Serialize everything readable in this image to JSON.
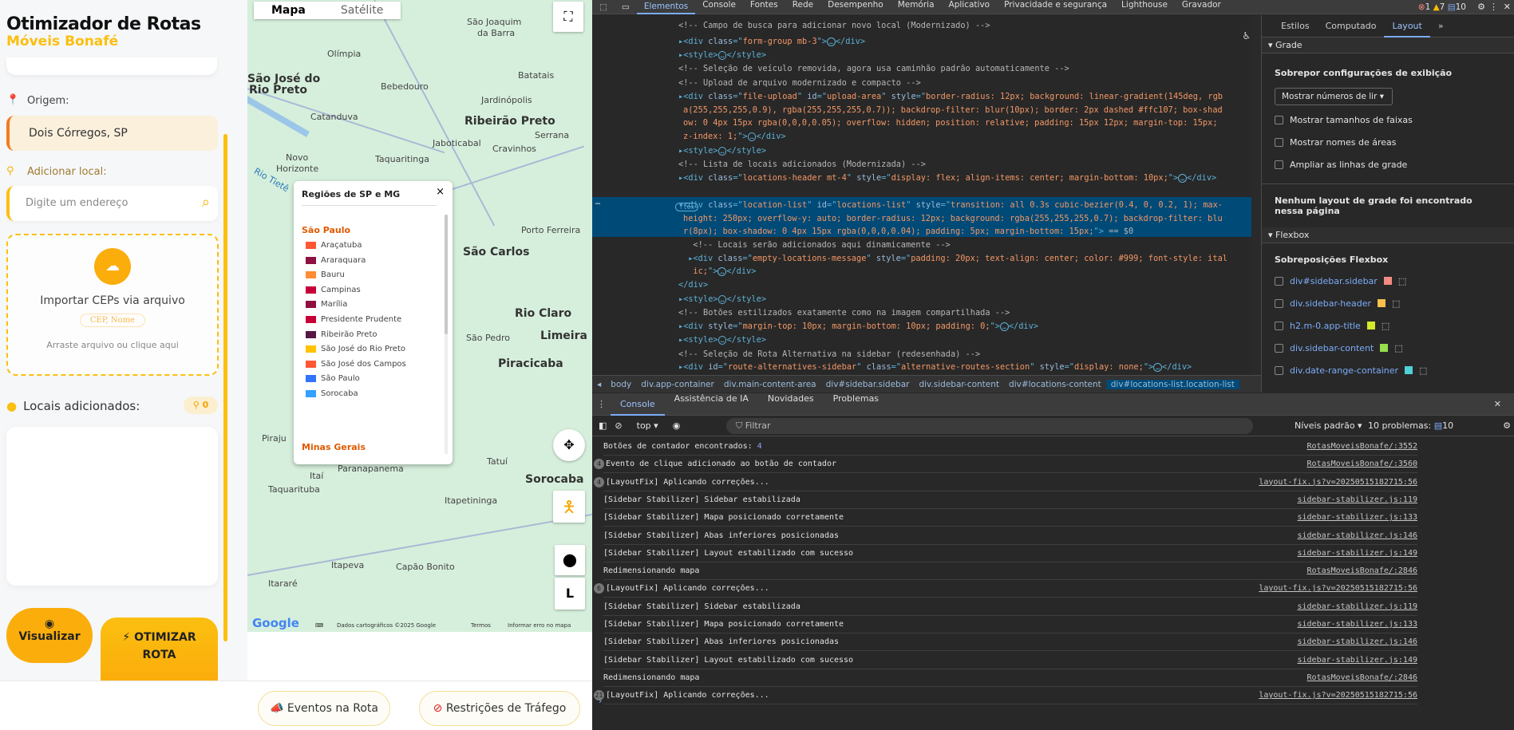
{
  "sidebar": {
    "title": "Otimizador de Rotas",
    "subtitle": "Móveis Bonafé",
    "origin_label": "Origem:",
    "origin_value": "Dois Córregos, SP",
    "add_label": "Adicionar local:",
    "add_placeholder": "Digite um endereço",
    "upload_title": "Importar CEPs via arquivo",
    "upload_format": "CEP, Nome",
    "upload_hint": "Arraste arquivo ou clique aqui",
    "locations_title": "Locais adicionados:",
    "locations_count": "0",
    "visualize": "Visualizar",
    "optimize_line1": "OTIMIZAR",
    "optimize_line2": "ROTA"
  },
  "bottom": {
    "events": "Eventos na Rota",
    "restrictions": "Restrições de Tráfego"
  },
  "map": {
    "type_map": "Mapa",
    "type_satellite": "Satélite",
    "peg": "L",
    "labels": [
      [
        "São José do",
        0,
        52,
        "b"
      ],
      [
        "Rio Preto",
        2,
        60,
        "b"
      ],
      [
        "Olímpia",
        100,
        35,
        ""
      ],
      [
        "Bebedouro",
        167,
        58,
        ""
      ],
      [
        "São Joaquim",
        275,
        12,
        ""
      ],
      [
        "da Barra",
        288,
        20,
        ""
      ],
      [
        "Batatais",
        339,
        50,
        ""
      ],
      [
        "Jardinópolis",
        293,
        68,
        ""
      ],
      [
        "Ribeirão Preto",
        272,
        82,
        "b"
      ],
      [
        "Serrana",
        360,
        93,
        ""
      ],
      [
        "Catanduva",
        79,
        80,
        ""
      ],
      [
        "Jaboticabal",
        232,
        99,
        ""
      ],
      [
        "Cravinhos",
        307,
        103,
        ""
      ],
      [
        "Novo",
        48,
        109,
        ""
      ],
      [
        "Horizonte",
        36,
        117,
        ""
      ],
      [
        "Taquaritinga",
        160,
        110,
        ""
      ],
      [
        "Porto Ferreira",
        343,
        161,
        ""
      ],
      [
        "São Carlos",
        270,
        176,
        "b"
      ],
      [
        "Rio Claro",
        335,
        220,
        "b"
      ],
      [
        "Limeira",
        367,
        236,
        "b"
      ],
      [
        "São Pedro",
        274,
        238,
        ""
      ],
      [
        "Piracicaba",
        314,
        256,
        "b"
      ],
      [
        "Piraju",
        18,
        310,
        ""
      ],
      [
        "Tatuí",
        300,
        327,
        ""
      ],
      [
        "Paranapanema",
        113,
        332,
        ""
      ],
      [
        "Sorocaba",
        348,
        339,
        "b"
      ],
      [
        "Itaí",
        78,
        337,
        ""
      ],
      [
        "Taquarituba",
        26,
        347,
        ""
      ],
      [
        "Itapetininga",
        247,
        355,
        ""
      ],
      [
        "Itapeva",
        105,
        401,
        ""
      ],
      [
        "Capão Bonito",
        186,
        402,
        ""
      ],
      [
        "Itararé",
        26,
        414,
        ""
      ],
      [
        "Rio Tietê",
        6,
        125,
        ""
      ]
    ],
    "attribution": "Dados cartográficos ©2025 Google",
    "terms": "Termos",
    "report": "Informar erro no mapa",
    "google": "Google"
  },
  "legend": {
    "title": "Regiões de SP e MG",
    "section1": "São Paulo",
    "section2": "Minas Gerais",
    "items": [
      [
        "Araçatuba",
        "#ff5733"
      ],
      [
        "Araraquara",
        "#8e1040"
      ],
      [
        "Bauru",
        "#ff8c33"
      ],
      [
        "Campinas",
        "#c70039"
      ],
      [
        "Marília",
        "#8e1040"
      ],
      [
        "Presidente Prudente",
        "#c70039"
      ],
      [
        "Ribeirão Preto",
        "#581845"
      ],
      [
        "São José do Rio Preto",
        "#ffc300"
      ],
      [
        "São José dos Campos",
        "#ff5733"
      ],
      [
        "São Paulo",
        "#3374ff"
      ],
      [
        "Sorocaba",
        "#33a1ff"
      ]
    ]
  },
  "devtools": {
    "tabs": [
      "Elementos",
      "Console",
      "Fontes",
      "Rede",
      "Desempenho",
      "Memória",
      "Aplicativo",
      "Privacidade e segurança",
      "Lighthouse",
      "Gravador"
    ],
    "errors": "1",
    "warnings": "7",
    "infos": "10",
    "code": [
      [
        24,
        [
          [
            "cm",
            "<!-- Campo de busca para adicionar novo local (Modernizado) -->"
          ]
        ]
      ],
      [
        44,
        [
          [
            "tag",
            "▸<div "
          ],
          [
            "an",
            "class"
          ],
          [
            "tag",
            "=\""
          ],
          [
            "av",
            "form-group mb-3"
          ],
          [
            "tag",
            "\">"
          ],
          [
            "dots",
            "…"
          ],
          [
            "tag",
            "</div>"
          ]
        ]
      ],
      [
        61,
        [
          [
            "tag",
            "▸<style>"
          ],
          [
            "dots",
            "…"
          ],
          [
            "tag",
            "</style>"
          ]
        ]
      ],
      [
        78,
        [
          [
            "cm",
            "<!-- Seleção de veículo removida, agora usa caminhão padrão automaticamente -->"
          ]
        ]
      ],
      [
        96,
        [
          [
            "cm",
            "<!-- Upload de arquivo modernizado e compacto -->"
          ]
        ]
      ],
      [
        113,
        [
          [
            "tag",
            "▸<div "
          ],
          [
            "an",
            "class"
          ],
          [
            "tag",
            "=\""
          ],
          [
            "av",
            "file-upload"
          ],
          [
            "tag",
            "\" "
          ],
          [
            "an",
            "id"
          ],
          [
            "tag",
            "=\""
          ],
          [
            "av",
            "upload-area"
          ],
          [
            "tag",
            "\" "
          ],
          [
            "an",
            "style"
          ],
          [
            "tag",
            "=\""
          ],
          [
            "av",
            "border-radius: 12px; background: linear-gradient(145deg, rgb"
          ]
        ]
      ],
      [
        130,
        [
          [
            "av",
            "a(255,255,255,0.9), rgba(255,255,255,0.7)); backdrop-filter: blur(10px); border: 2px dashed #ffc107; box-shad"
          ]
        ]
      ],
      [
        146,
        [
          [
            "av",
            "ow: 0 4px 15px rgba(0,0,0,0.05); overflow: hidden; position: relative; padding: 15px 12px; margin-top: 15px;"
          ]
        ]
      ],
      [
        163,
        [
          [
            "av",
            "z-index: 1;"
          ],
          [
            "tag",
            "\">"
          ],
          [
            "dots",
            "…"
          ],
          [
            "tag",
            "</div>"
          ]
        ]
      ],
      [
        181,
        [
          [
            "tag",
            "▸<style>"
          ],
          [
            "dots",
            "…"
          ],
          [
            "tag",
            "</style>"
          ]
        ]
      ],
      [
        198,
        [
          [
            "cm",
            "<!-- Lista de locais adicionados (Modernizada) -->"
          ]
        ]
      ],
      [
        215,
        [
          [
            "tag",
            "▸<div "
          ],
          [
            "an",
            "class"
          ],
          [
            "tag",
            "=\""
          ],
          [
            "av",
            "locations-header mt-4"
          ],
          [
            "tag",
            "\" "
          ],
          [
            "an",
            "style"
          ],
          [
            "tag",
            "=\""
          ],
          [
            "av",
            "display: flex; align-items: center; margin-bottom: 10px;"
          ],
          [
            "tag",
            "\">"
          ],
          [
            "dots",
            "…"
          ],
          [
            "tag",
            "</div>"
          ]
        ]
      ],
      [
        249,
        [
          [
            "tag",
            "▾<div "
          ],
          [
            "an",
            "class"
          ],
          [
            "tag",
            "=\""
          ],
          [
            "av",
            "location-list"
          ],
          [
            "tag",
            "\" "
          ],
          [
            "an",
            "id"
          ],
          [
            "tag",
            "=\""
          ],
          [
            "av",
            "locations-list"
          ],
          [
            "tag",
            "\" "
          ],
          [
            "an",
            "style"
          ],
          [
            "tag",
            "=\""
          ],
          [
            "av",
            "transition: all 0.3s cubic-bezier(0.4, 0, 0.2, 1); max-"
          ]
        ]
      ],
      [
        266,
        [
          [
            "av",
            "height: 250px; overflow-y: auto; border-radius: 12px; background: rgba(255,255,255,0.7); backdrop-filter: blu"
          ]
        ]
      ],
      [
        282,
        [
          [
            "av",
            "r(8px); box-shadow: 0 4px 15px rgba(0,0,0,0.04); padding: 5px; margin-bottom: 15px;"
          ],
          [
            "tag",
            "\">"
          ],
          [
            "cm",
            " == $0"
          ]
        ]
      ],
      [
        299,
        [
          [
            "cm",
            "  <!-- Locais serão adicionados aqui dinamicamente -->"
          ]
        ]
      ],
      [
        316,
        [
          [
            "tag",
            " ▸<div "
          ],
          [
            "an",
            "class"
          ],
          [
            "tag",
            "=\""
          ],
          [
            "av",
            "empty-locations-message"
          ],
          [
            "tag",
            "\" "
          ],
          [
            "an",
            "style"
          ],
          [
            "tag",
            "=\""
          ],
          [
            "av",
            "padding: 20px; text-align: center; color: #999; font-style: ital"
          ]
        ]
      ],
      [
        332,
        [
          [
            "av",
            "  ic;"
          ],
          [
            "tag",
            "\">"
          ],
          [
            "dots",
            "…"
          ],
          [
            "tag",
            "</div>"
          ]
        ]
      ],
      [
        349,
        [
          [
            "tag",
            "</div>"
          ]
        ]
      ],
      [
        367,
        [
          [
            "tag",
            "▸<style>"
          ],
          [
            "dots",
            "…"
          ],
          [
            "tag",
            "</style>"
          ]
        ]
      ],
      [
        384,
        [
          [
            "cm",
            "<!-- Botões estilizados exatamente como na imagem compartilhada -->"
          ]
        ]
      ],
      [
        401,
        [
          [
            "tag",
            "▸<div "
          ],
          [
            "an",
            "style"
          ],
          [
            "tag",
            "=\""
          ],
          [
            "av",
            "margin-top: 10px; margin-bottom: 10px; padding: 0;"
          ],
          [
            "tag",
            "\">"
          ],
          [
            "dots",
            "…"
          ],
          [
            "tag",
            "</div>"
          ]
        ]
      ],
      [
        418,
        [
          [
            "tag",
            "▸<style>"
          ],
          [
            "dots",
            "…"
          ],
          [
            "tag",
            "</style>"
          ]
        ]
      ],
      [
        436,
        [
          [
            "cm",
            "<!-- Seleção de Rota Alternativa na sidebar (redesenhada) -->"
          ]
        ]
      ],
      [
        452,
        [
          [
            "tag",
            "▸<div "
          ],
          [
            "an",
            "id"
          ],
          [
            "tag",
            "=\""
          ],
          [
            "av",
            "route-alternatives-sidebar"
          ],
          [
            "tag",
            "\" "
          ],
          [
            "an",
            "class"
          ],
          [
            "tag",
            "=\""
          ],
          [
            "av",
            "alternative-routes-section"
          ],
          [
            "tag",
            "\" "
          ],
          [
            "an",
            "style"
          ],
          [
            "tag",
            "=\""
          ],
          [
            "av",
            "display: none;"
          ],
          [
            "tag",
            "\">"
          ],
          [
            "dots",
            "…"
          ],
          [
            "tag",
            "</div>"
          ]
        ]
      ]
    ],
    "flex_badge": "flex",
    "breadcrumbs": [
      "body",
      "div.app-container",
      "div.main-content-area",
      "div#sidebar.sidebar",
      "div.sidebar-content",
      "div#locations-content",
      "div#locations-list.location-list"
    ],
    "side_tabs": [
      "Estilos",
      "Computado",
      "Layout"
    ],
    "grid": {
      "section": "Grade",
      "overlay_title": "Sobrepor configurações de exibição",
      "select": "Mostrar números de lir",
      "checks": [
        "Mostrar tamanhos de faixas",
        "Mostrar nomes de áreas",
        "Ampliar as linhas de grade"
      ],
      "none": "Nenhum layout de grade foi encontrado nessa página"
    },
    "flexbox": {
      "section": "Flexbox",
      "title": "Sobreposições Flexbox",
      "items": [
        [
          "div#sidebar.sidebar",
          "#f28b82"
        ],
        [
          "div.sidebar-header",
          "#f6bf4f"
        ],
        [
          "h2.m-0.app-title",
          "#d4e82c"
        ],
        [
          "div.sidebar-content",
          "#95e04b"
        ],
        [
          "div.date-range-container",
          "#4fd1d9"
        ]
      ]
    },
    "console_tabs": [
      "Console",
      "Assistência de IA",
      "Novidades",
      "Problemas"
    ],
    "context": "top",
    "filter_placeholder": "Filtrar",
    "levels": "Níveis padrão",
    "problems": "10 problemas:",
    "problems_count": "10",
    "logs": [
      [
        "",
        "Botões de contador encontrados: ",
        "4",
        "RotasMoveisBonafe/:3552"
      ],
      [
        "4",
        "Evento de clique adicionado ao botão de contador",
        "",
        "RotasMoveisBonafe/:3560"
      ],
      [
        "4",
        "[LayoutFix] Aplicando correções...",
        "",
        "layout-fix.js?v=20250515182715:56"
      ],
      [
        "",
        "[Sidebar Stabilizer] Sidebar estabilizada",
        "",
        "sidebar-stabilizer.js:119"
      ],
      [
        "",
        "[Sidebar Stabilizer] Mapa posicionado corretamente",
        "",
        "sidebar-stabilizer.js:133"
      ],
      [
        "",
        "[Sidebar Stabilizer] Abas inferiores posicionadas",
        "",
        "sidebar-stabilizer.js:146"
      ],
      [
        "",
        "[Sidebar Stabilizer] Layout estabilizado com sucesso",
        "",
        "sidebar-stabilizer.js:149"
      ],
      [
        "",
        "Redimensionando mapa",
        "",
        "RotasMoveisBonafe/:2846"
      ],
      [
        "6",
        "[LayoutFix] Aplicando correções...",
        "",
        "layout-fix.js?v=20250515182715:56"
      ],
      [
        "",
        "[Sidebar Stabilizer] Sidebar estabilizada",
        "",
        "sidebar-stabilizer.js:119"
      ],
      [
        "",
        "[Sidebar Stabilizer] Mapa posicionado corretamente",
        "",
        "sidebar-stabilizer.js:133"
      ],
      [
        "",
        "[Sidebar Stabilizer] Abas inferiores posicionadas",
        "",
        "sidebar-stabilizer.js:146"
      ],
      [
        "",
        "[Sidebar Stabilizer] Layout estabilizado com sucesso",
        "",
        "sidebar-stabilizer.js:149"
      ],
      [
        "",
        "Redimensionando mapa",
        "",
        "RotasMoveisBonafe/:2846"
      ],
      [
        "21",
        "[LayoutFix] Aplicando correções...",
        "",
        "layout-fix.js?v=20250515182715:56"
      ]
    ],
    "prompt": "›"
  }
}
